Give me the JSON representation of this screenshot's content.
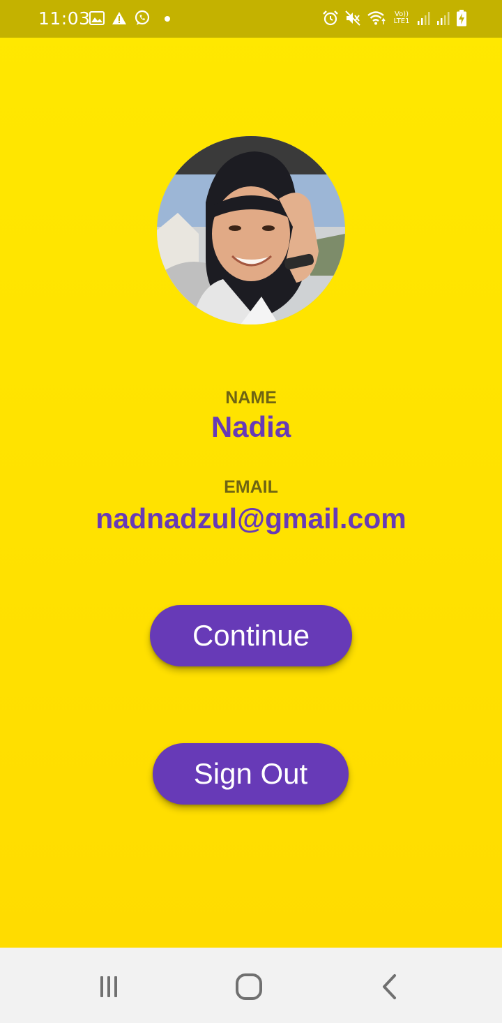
{
  "status_bar": {
    "time": "11:03",
    "left_icons": [
      "gallery-icon",
      "warning-icon",
      "whatsapp-icon",
      "dot-icon"
    ],
    "right_icons": [
      "alarm-icon",
      "mute-icon",
      "wifi-icon",
      "volte-icon",
      "signal-icon",
      "signal-icon",
      "battery-charging-icon"
    ],
    "volte_top": "Vo))",
    "volte_bottom": "LTE1"
  },
  "profile": {
    "avatar_alt": "avatar",
    "name_label": "NAME",
    "name_value": "Nadia",
    "email_label": "EMAIL",
    "email_value": "nadnadzul@gmail.com"
  },
  "actions": {
    "continue_label": "Continue",
    "sign_out_label": "Sign Out"
  },
  "nav_bar": {
    "icons": [
      "recents-icon",
      "home-icon",
      "back-icon"
    ]
  },
  "colors": {
    "background": "#ffe400",
    "status_bar": "#c4b200",
    "accent": "#673ab7",
    "label": "#6f6413",
    "nav_bar": "#f2f2f2"
  }
}
